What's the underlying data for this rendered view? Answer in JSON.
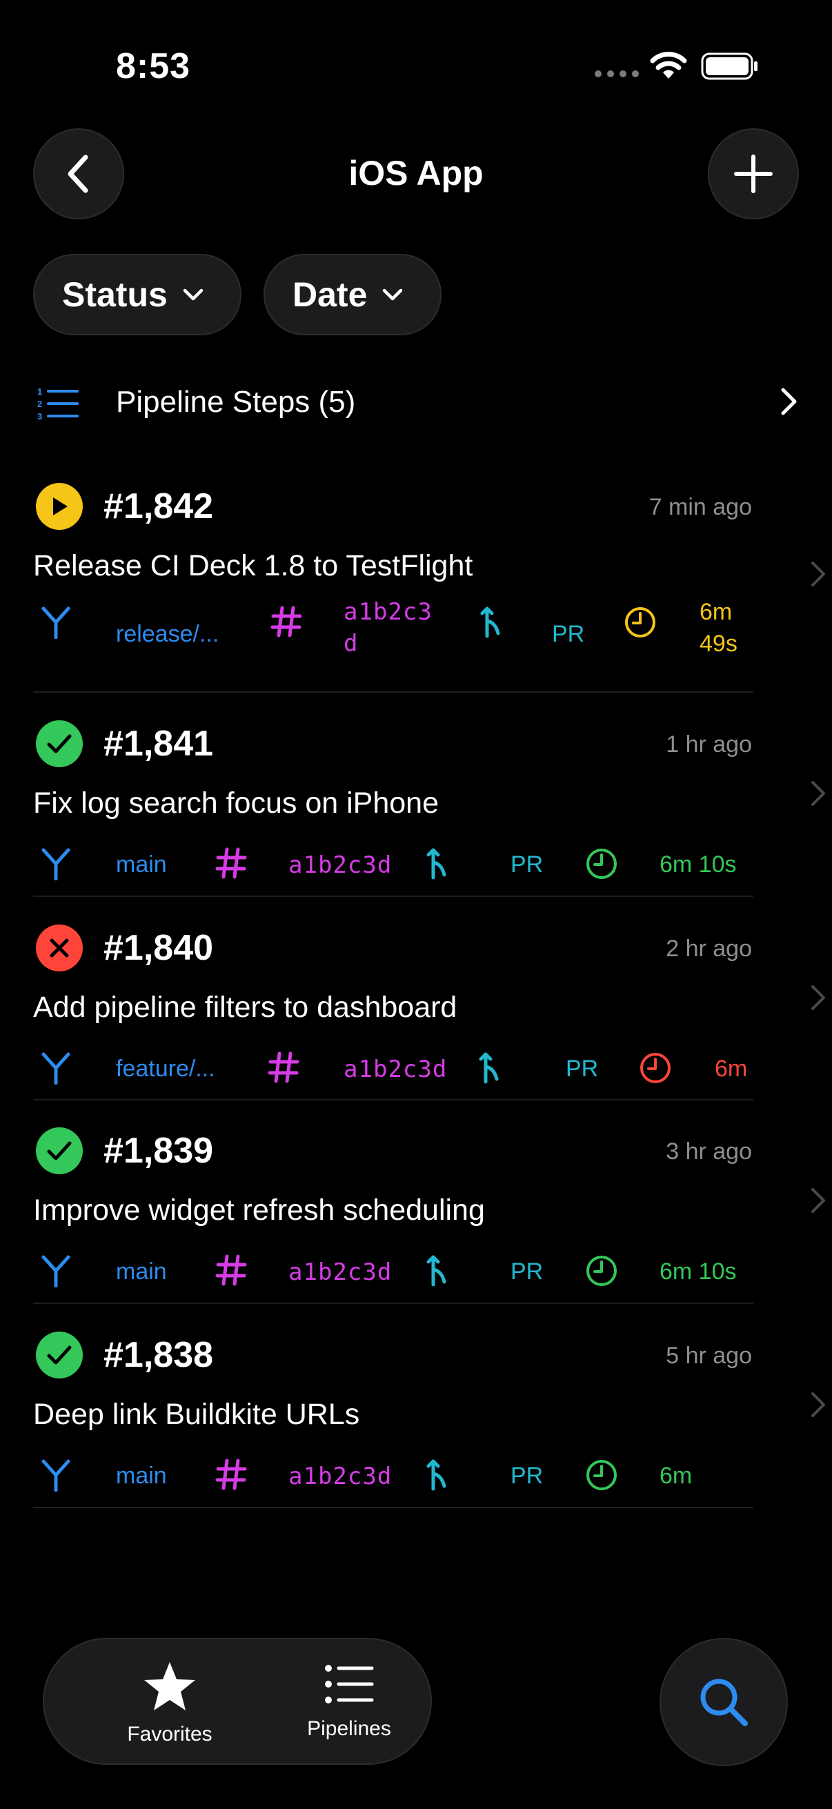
{
  "status_bar": {
    "time": "8:53"
  },
  "nav": {
    "title": "iOS App"
  },
  "filters": {
    "status_label": "Status",
    "date_label": "Date"
  },
  "pipeline_steps": {
    "label": "Pipeline Steps (5)"
  },
  "builds": [
    {
      "number": "#1,842",
      "ago": "7 min ago",
      "title": "Release CI Deck 1.8 to TestFlight",
      "branch": "release/...",
      "commit": "a1b2c3d",
      "source": "PR",
      "duration": "6m 49s",
      "status": "running",
      "status_color": "#f5c518"
    },
    {
      "number": "#1,841",
      "ago": "1 hr ago",
      "title": "Fix log search focus on iPhone",
      "branch": "main",
      "commit": "a1b2c3d",
      "source": "PR",
      "duration": "6m 10s",
      "status": "passed",
      "status_color": "#34c759"
    },
    {
      "number": "#1,840",
      "ago": "2 hr ago",
      "title": "Add pipeline filters to dashboard",
      "branch": "feature/...",
      "commit": "a1b2c3d",
      "source": "PR",
      "duration": "6m",
      "status": "failed",
      "status_color": "#ff453a"
    },
    {
      "number": "#1,839",
      "ago": "3 hr ago",
      "title": "Improve widget refresh scheduling",
      "branch": "main",
      "commit": "a1b2c3d",
      "source": "PR",
      "duration": "6m 10s",
      "status": "passed",
      "status_color": "#34c759"
    },
    {
      "number": "#1,838",
      "ago": "5 hr ago",
      "title": "Deep link Buildkite URLs",
      "branch": "main",
      "commit": "a1b2c3d",
      "source": "PR",
      "duration": "6m",
      "status": "passed",
      "status_color": "#34c759"
    }
  ],
  "tabbar": {
    "favorites_label": "Favorites",
    "pipelines_label": "Pipelines"
  },
  "icons": {
    "back": "chevron-left-icon",
    "add": "plus-icon",
    "search": "search-icon",
    "favorites": "star-icon",
    "pipelines": "list-icon"
  },
  "colors": {
    "accent": "#2d8cf0",
    "commit": "#d63ce6",
    "source": "#22b8cf"
  }
}
